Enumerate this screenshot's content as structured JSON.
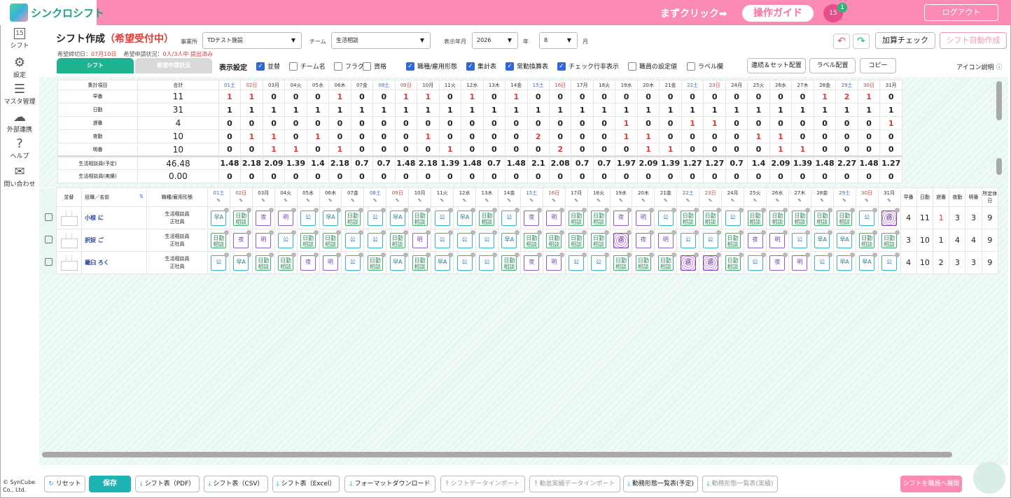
{
  "app": {
    "logo_text": "シンクロシフト",
    "guide_prompt": "まずクリック➡",
    "guide_button": "操作ガイド",
    "calendar_badge": "1",
    "calendar_day": "15",
    "logout": "ログアウト",
    "copyright": "© SynCube Co., Ltd."
  },
  "sidebar": [
    {
      "icon": "calendar-icon",
      "glyph": "15",
      "label": "シフト"
    },
    {
      "icon": "gear-icon",
      "glyph": "⚙",
      "label": "設定"
    },
    {
      "icon": "database-icon",
      "glyph": "☰",
      "label": "マスタ管理"
    },
    {
      "icon": "cloud-icon",
      "glyph": "☁",
      "label": "外部連携"
    },
    {
      "icon": "help-icon",
      "glyph": "?",
      "label": "ヘルプ"
    },
    {
      "icon": "mail-icon",
      "glyph": "✉",
      "label": "問い合わせ"
    }
  ],
  "header": {
    "title": "シフト作成",
    "title_status": "（希望受付中）",
    "deadline_label": "希望締切日：",
    "deadline": "07月10日",
    "request_label": "希望申請状況：",
    "request_status": "0人/3人中 提出済み",
    "office_label": "事業所",
    "office": "TDテスト施設",
    "team_label": "チーム",
    "team": "生活相談",
    "year_label": "表示年月",
    "year": "2026",
    "year_unit": "年",
    "month": "8",
    "month_unit": "月",
    "calc_check": "加算チェック",
    "auto_create": "シフト自動作成",
    "undo": "↶",
    "redo": "↷"
  },
  "tabs": {
    "shift": "シフト",
    "request": "希望申請状況"
  },
  "display": {
    "label": "表示設定",
    "options": [
      {
        "label": "並替",
        "on": true
      },
      {
        "label": "チーム名",
        "on": false
      },
      {
        "label": "フラグ",
        "on": false
      },
      {
        "label": "資格",
        "on": false
      },
      {
        "label": "職種/雇用形態",
        "on": true
      },
      {
        "label": "集計表",
        "on": true
      },
      {
        "label": "常勤換算表",
        "on": true
      },
      {
        "label": "チェック行非表示",
        "on": true
      },
      {
        "label": "職員の設定値",
        "on": false
      },
      {
        "label": "ラベル欄",
        "on": false
      }
    ],
    "buttons": [
      "連続＆セット配置",
      "ラベル配置",
      "コピー"
    ],
    "icon_help": "アイコン説明"
  },
  "days": [
    "01土",
    "02日",
    "03月",
    "04火",
    "05水",
    "06木",
    "07金",
    "08土",
    "09日",
    "10月",
    "11火",
    "12水",
    "13木",
    "14金",
    "15土",
    "16日",
    "17月",
    "18火",
    "19水",
    "20木",
    "21金",
    "22土",
    "23日",
    "24月",
    "25火",
    "26水",
    "27木",
    "28金",
    "29土",
    "30日",
    "31月"
  ],
  "summary": {
    "headers": [
      "集計項目",
      "合計"
    ],
    "rows": [
      {
        "name": "早番",
        "total": "11",
        "vals": [
          "1",
          "1",
          "0",
          "0",
          "0",
          "1",
          "0",
          "0",
          "1",
          "1",
          "0",
          "1",
          "0",
          "1",
          "0",
          "0",
          "0",
          "0",
          "0",
          "0",
          "0",
          "0",
          "0",
          "0",
          "0",
          "0",
          "0",
          "1",
          "2",
          "1",
          "0"
        ]
      },
      {
        "name": "日勤",
        "total": "31",
        "vals": [
          "1",
          "1",
          "1",
          "1",
          "1",
          "1",
          "1",
          "1",
          "1",
          "1",
          "1",
          "1",
          "1",
          "1",
          "1",
          "1",
          "1",
          "1",
          "1",
          "1",
          "1",
          "1",
          "1",
          "1",
          "1",
          "1",
          "1",
          "1",
          "1",
          "1",
          "1"
        ]
      },
      {
        "name": "遅番",
        "total": "4",
        "vals": [
          "0",
          "0",
          "0",
          "0",
          "0",
          "0",
          "0",
          "0",
          "0",
          "0",
          "0",
          "0",
          "0",
          "0",
          "0",
          "0",
          "0",
          "0",
          "1",
          "0",
          "0",
          "1",
          "1",
          "0",
          "0",
          "0",
          "0",
          "0",
          "0",
          "0",
          "1"
        ]
      },
      {
        "name": "夜勤",
        "total": "10",
        "vals": [
          "0",
          "1",
          "1",
          "0",
          "1",
          "0",
          "0",
          "0",
          "0",
          "1",
          "0",
          "0",
          "0",
          "0",
          "2",
          "0",
          "0",
          "0",
          "1",
          "1",
          "0",
          "0",
          "0",
          "0",
          "1",
          "1",
          "0",
          "0",
          "0",
          "0",
          "0"
        ]
      },
      {
        "name": "明番",
        "total": "10",
        "vals": [
          "0",
          "0",
          "1",
          "1",
          "0",
          "1",
          "0",
          "0",
          "0",
          "0",
          "1",
          "0",
          "0",
          "0",
          "0",
          "2",
          "0",
          "0",
          "0",
          "1",
          "1",
          "0",
          "0",
          "0",
          "0",
          "1",
          "1",
          "0",
          "0",
          "0",
          "0"
        ]
      },
      {
        "name": "生活相談員(予定)",
        "total": "46.48",
        "vals": [
          "1.48",
          "2.18",
          "2.09",
          "1.39",
          "1.4",
          "2.18",
          "0.7",
          "0.7",
          "1.48",
          "2.18",
          "1.39",
          "1.48",
          "0.7",
          "1.48",
          "2.1",
          "2.08",
          "0.7",
          "0.7",
          "1.97",
          "2.09",
          "1.39",
          "1.27",
          "1.27",
          "0.7",
          "1.4",
          "2.09",
          "1.39",
          "1.48",
          "2.27",
          "1.48",
          "1.27"
        ]
      },
      {
        "name": "生活相談員(実績)",
        "total": "0.00",
        "vals": [
          "0",
          "0",
          "0",
          "0",
          "0",
          "0",
          "0",
          "0",
          "0",
          "0",
          "0",
          "0",
          "0",
          "0",
          "0",
          "0",
          "0",
          "0",
          "0",
          "0",
          "0",
          "0",
          "0",
          "0",
          "0",
          "0",
          "0",
          "0",
          "0",
          "0",
          "0"
        ]
      }
    ]
  },
  "staff": {
    "headers": {
      "sort": "並替",
      "name": "役職／名前",
      "job": "職種/雇用形態",
      "totals": [
        "早番",
        "日勤",
        "遅番",
        "夜勤",
        "明番",
        "所定休日"
      ]
    },
    "rows": [
      {
        "name": "小椋 に",
        "job": "生活相談員",
        "emp": "正社員",
        "shifts": [
          "早A",
          "日勤相談",
          "夜",
          "明",
          "公",
          "早A",
          "日勤相談",
          "公",
          "早A",
          "日勤相談",
          "公",
          "早A",
          "日勤相談",
          "公",
          "夜",
          "明",
          "日勤相談",
          "日勤相談",
          "夜",
          "明",
          "公",
          "日勤相談",
          "日勤相談",
          "公",
          "日勤相談",
          "日勤相談",
          "日勤相談",
          "日勤相談",
          "日勤相談",
          "公",
          "遅"
        ],
        "totals": [
          "4",
          "11",
          "1",
          "3",
          "3",
          "9"
        ]
      },
      {
        "name": "択捉 ご",
        "job": "生活相談員",
        "emp": "正社員",
        "shifts": [
          "日勤相談",
          "夜",
          "明",
          "公",
          "日勤相談",
          "日勤相談",
          "公",
          "公",
          "日勤相談",
          "明",
          "公",
          "公",
          "公",
          "早A",
          "日勤相談",
          "日勤相談",
          "日勤相談",
          "日勤相談",
          "遅",
          "夜",
          "明",
          "公",
          "公",
          "日勤相談",
          "夜",
          "明",
          "公",
          "早A",
          "早A",
          "日勤相談",
          "日勤相談"
        ],
        "totals": [
          "3",
          "10",
          "1",
          "4",
          "4",
          "9"
        ]
      },
      {
        "name": "羅臼 ろく",
        "job": "生活相談員",
        "emp": "正社員",
        "shifts": [
          "公",
          "早A",
          "日勤相談",
          "日勤相談",
          "夜",
          "明",
          "公",
          "日勤相談",
          "早A",
          "日勤相談",
          "早A",
          "公",
          "公",
          "日勤相談",
          "夜",
          "明",
          "公",
          "公",
          "日勤相談",
          "日勤相談",
          "日勤相談",
          "遅",
          "遅",
          "日勤相談",
          "公",
          "夜",
          "明",
          "公",
          "早A",
          "早A",
          "公"
        ],
        "totals": [
          "4",
          "10",
          "2",
          "3",
          "3",
          "9"
        ]
      }
    ]
  },
  "bottom": [
    "リセット",
    "保存",
    "シフト表（PDF）",
    "シフト表（CSV）",
    "シフト表（Excel）",
    "フォーマットダウンロード",
    "シフトデータインポート",
    "勤怠実績データインポート",
    "勤務形態一覧表(予定)",
    "勤務形態一覧表(実績)",
    "シフトを職員へ展開"
  ]
}
